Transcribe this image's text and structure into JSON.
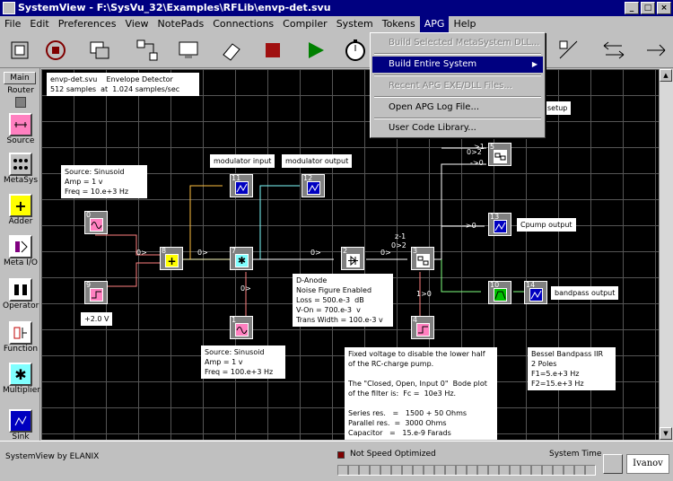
{
  "window": {
    "title": "SystemView - F:\\SysVu_32\\Examples\\RFLib\\envp-det.svu"
  },
  "menu": [
    "File",
    "Edit",
    "Preferences",
    "View",
    "NotePads",
    "Connections",
    "Compiler",
    "System",
    "Tokens",
    "APG",
    "Help"
  ],
  "dropdown": {
    "items": [
      {
        "label": "Build Selected MetaSystem DLL...",
        "disabled": true
      },
      {
        "label": "Build Entire System",
        "disabled": false,
        "selected": true,
        "arrow": "▶"
      },
      {
        "label": "Recent APG EXE/DLL Files...",
        "disabled": true
      },
      {
        "label": "Open APG Log File...",
        "disabled": false
      },
      {
        "label": "User Code Library...",
        "disabled": false
      }
    ]
  },
  "sidebar": {
    "tab": "Main",
    "items": [
      "Router",
      "Source",
      "MetaSys",
      "Adder",
      "Meta I/O",
      "Operator",
      "Function",
      "Multiplier",
      "Sink"
    ]
  },
  "notes": {
    "header": "envp-det.svu    Envelope Detector\n512 samples  at  1.024 samples/sec",
    "src0": "Source: Sinusoid\nAmp = 1 v\nFreq = 10.e+3 Hz",
    "mod_in": "modulator input",
    "mod_out": "modulator output",
    "dc": "+2.0 V",
    "src1": "Source: Sinusoid\nAmp = 1 v\nFreq = 100.e+3 Hz",
    "danode": "D-Anode\nNoise Figure Enabled\nLoss = 500.e-3  dB\nV-On = 700.e-3  v\nTrans Width = 100.e-3 v",
    "fixed": "Fixed voltage to disable the lower half\nof the RC-charge pump.\n\nThe \"Closed, Open, Input 0\"  Bode plot\nof the filter is:  Fc =  10e3 Hz.\n\nSeries res.   =   1500 + 50 Ohms\nParallel res.  =  3000 Ohms\nCapacitor   =   15.e-9 Farads",
    "bessel": "Bessel Bandpass IIR\n2 Poles\nF1=5.e+3 Hz\nF2=15.e+3 Hz",
    "cpump": "Cpump output",
    "bandpass": "bandpass output",
    "setup": "setup"
  },
  "tokens": {
    "t0": "0",
    "t1": "1",
    "t2": "2",
    "t3": "3",
    "t4": "4",
    "t5": "5",
    "t7": "7",
    "t8": "8",
    "t9": "9",
    "t10": "10",
    "t11": "11",
    "t12": "12",
    "t13": "13",
    "t14": "14"
  },
  "conn_labels": {
    "a": "0>2",
    "b": "0>",
    "c": "0>",
    "d": "0>",
    "e": "0>",
    "f": "0>",
    "g": "z-1",
    "h": "0>2",
    "i": "->0",
    "j": "->0",
    "k": ">1",
    "l": "1>0"
  },
  "status": {
    "left": "SystemView by ELANIX",
    "speed": "Not Speed Optimized",
    "time_label": "System Time",
    "user": "Ivanov"
  }
}
